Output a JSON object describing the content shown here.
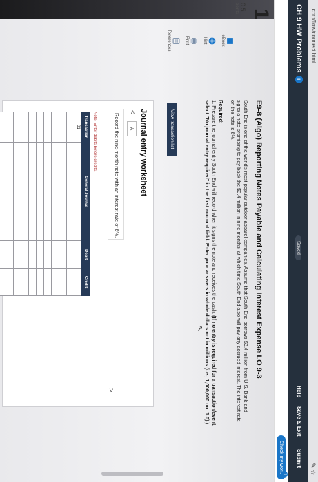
{
  "browser": {
    "url": "...com/flow/connect.html"
  },
  "header": {
    "title": "CH 9 HW Problems",
    "info_badge": "i",
    "saved": "Saved",
    "help": "Help",
    "save_exit": "Save & Exit",
    "submit": "Submit"
  },
  "toolbar": {
    "check_label": "Check my work",
    "check_count": "1"
  },
  "question": {
    "number": "1",
    "points": "0.5",
    "points_label": "points"
  },
  "side_tools": [
    {
      "icon": "ebook-icon",
      "label": "eBook"
    },
    {
      "icon": "hint-icon",
      "label": "Hint"
    },
    {
      "icon": "print-icon",
      "label": "Print"
    },
    {
      "icon": "references-icon",
      "label": "References"
    }
  ],
  "problem": {
    "heading": "E9-8 (Algo) Reporting Notes Payable and Calculating Interest Expense LO 9-3",
    "paragraph": "South End is one of the world's most popular outdoor apparel companies. Assume that South End borrows $3.4 million from U.S. Bank and signs a note promising to pay back the $3.4 million in nine months, at which time South End also will pay any accrued interest. The interest rate on the note is 6%.",
    "required_label": "Required:",
    "required_plain": "1. Prepare the journal entry South End will record when it signs the note and receives the cash. ",
    "required_bold": "(If no entry is required for a transaction/event, select \"No journal entry required\" in the first account field. Enter your answers in whole dollars not in millions (i.e., 1,000,000 not 1.0).)"
  },
  "view_button": "View transaction list",
  "worksheet": {
    "title": "Journal entry worksheet",
    "prev": "<",
    "tab": "A",
    "next": ">",
    "instruction": "Record the nine-month note with an interest rate of 6%.",
    "note": "Note: Enter debits before credits.",
    "columns": [
      "Transaction",
      "General Journal",
      "Debit",
      "Credit"
    ],
    "rows": [
      [
        "01",
        "",
        "",
        ""
      ],
      [
        "",
        "",
        "",
        ""
      ],
      [
        "",
        "",
        "",
        ""
      ],
      [
        "",
        "",
        "",
        ""
      ],
      [
        "",
        "",
        "",
        ""
      ],
      [
        "",
        "",
        "",
        ""
      ],
      [
        "",
        "",
        "",
        ""
      ],
      [
        "",
        "",
        "",
        ""
      ],
      [
        "",
        "",
        "",
        ""
      ],
      [
        "",
        "",
        "",
        ""
      ],
      [
        "",
        "",
        "",
        ""
      ],
      [
        "",
        "",
        "",
        ""
      ]
    ]
  }
}
